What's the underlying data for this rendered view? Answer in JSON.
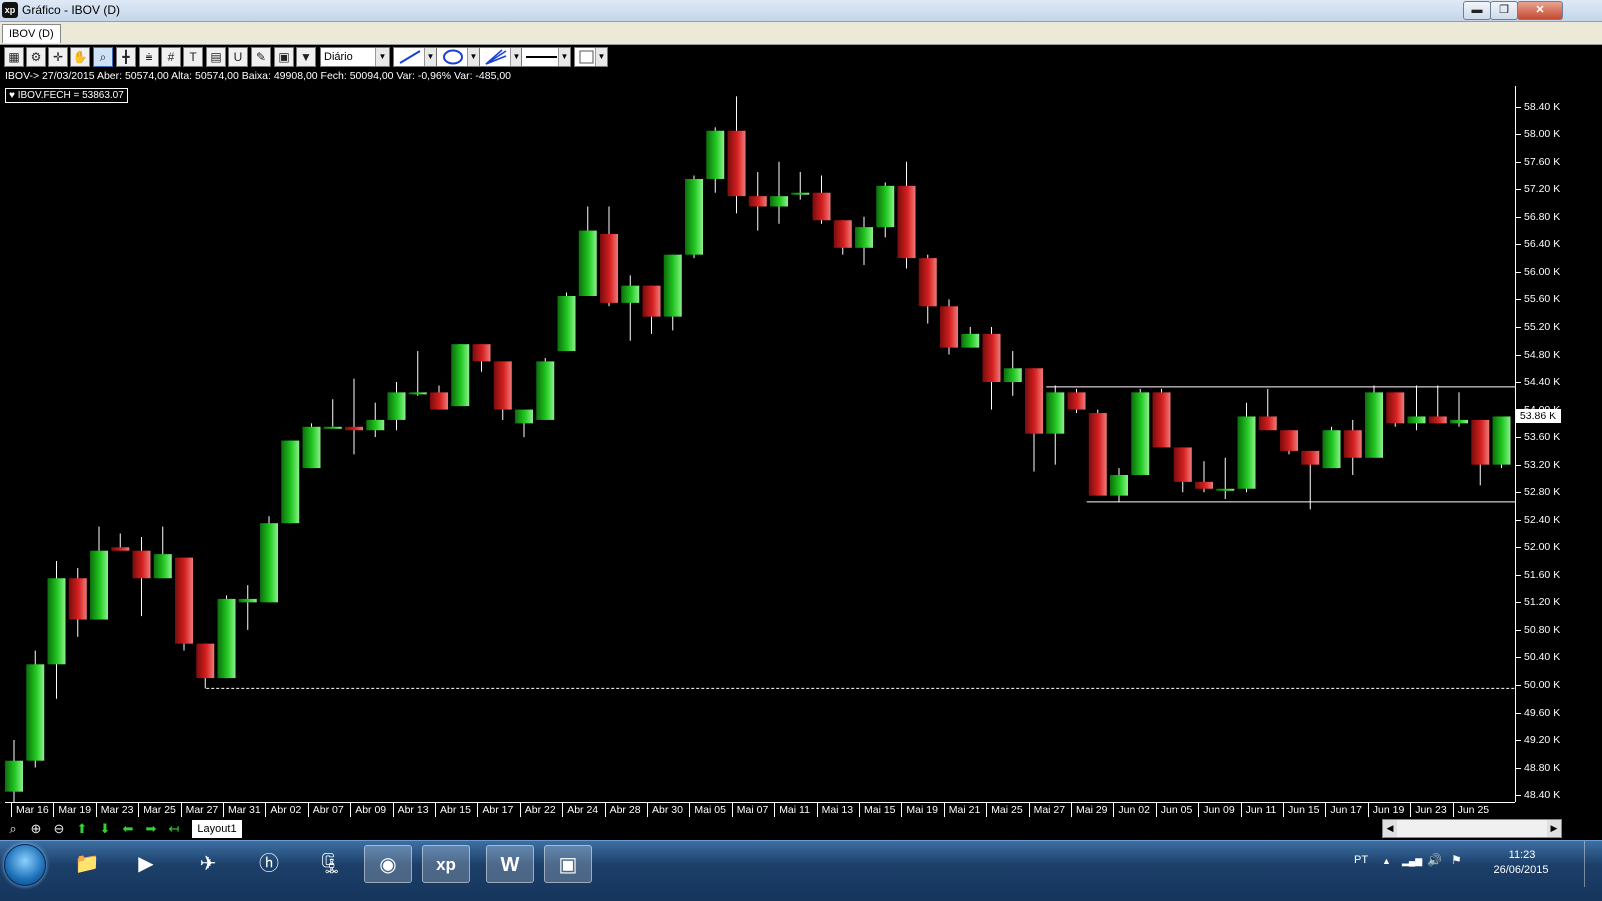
{
  "window": {
    "title": "Gráfico - IBOV (D)",
    "app_icon_text": "xp",
    "minimize_glyph": "▬",
    "maximize_glyph": "❐",
    "close_glyph": "✕",
    "document_tab": "IBOV (D)"
  },
  "toolbar": {
    "period_select": "Diário",
    "icons": [
      "chart-icon",
      "gear-icon",
      "crosshair-icon",
      "hand-icon",
      "zoom-chart-icon",
      "cursor-icon",
      "lines-icon",
      "grid-icon",
      "text-icon",
      "calculator-icon",
      "magnet-icon",
      "brush-icon",
      "clipboard-icon",
      "filter-icon"
    ],
    "glyphs": [
      "▦",
      "⚙",
      "✛",
      "✋",
      "⌕",
      "╋",
      "⩧",
      "#",
      "T",
      "▤",
      "U",
      "✎",
      "▣",
      "▼"
    ],
    "dropdown_arrow": "▼"
  },
  "info_line": "IBOV-> 27/03/2015 Aber: 50574,00 Alta: 50574,00 Baixa: 49908,00 Fech: 50094,00 Var: -0,96% Var: -485,00",
  "legend": "♥ IBOV.FECH = 53863.07",
  "current_price_label": "53.86 K",
  "colors": {
    "up": "#22c922",
    "down": "#d62020",
    "background": "#000000",
    "axis": "#ffffff"
  },
  "chart_data": {
    "type": "candlestick",
    "symbol": "IBOV",
    "ylim": [
      48300,
      58700
    ],
    "y_ticks": [
      "58.40 K",
      "58.00 K",
      "57.60 K",
      "57.20 K",
      "56.80 K",
      "56.40 K",
      "56.00 K",
      "55.60 K",
      "55.20 K",
      "54.80 K",
      "54.40 K",
      "54.00 K",
      "53.60 K",
      "53.20 K",
      "52.80 K",
      "52.40 K",
      "52.00 K",
      "51.60 K",
      "51.20 K",
      "50.80 K",
      "50.40 K",
      "50.00 K",
      "49.60 K",
      "49.20 K",
      "48.80 K",
      "48.40 K"
    ],
    "y_tick_values": [
      58400,
      58000,
      57600,
      57200,
      56800,
      56400,
      56000,
      55600,
      55200,
      54800,
      54400,
      54000,
      53600,
      53200,
      52800,
      52400,
      52000,
      51600,
      51200,
      50800,
      50400,
      50000,
      49600,
      49200,
      48800,
      48400
    ],
    "x_labels": [
      "Mar 16",
      "Mar 19",
      "Mar 23",
      "Mar 25",
      "Mar 27",
      "Mar 31",
      "Abr 02",
      "Abr 07",
      "Abr 09",
      "Abr 13",
      "Abr 15",
      "Abr 17",
      "Abr 22",
      "Abr 24",
      "Abr 28",
      "Abr 30",
      "Mai 05",
      "Mai 07",
      "Mai 11",
      "Mai 13",
      "Mai 15",
      "Mai 19",
      "Mai 21",
      "Mai 25",
      "Mai 27",
      "Mai 29",
      "Jun 02",
      "Jun 05",
      "Jun 09",
      "Jun 11",
      "Jun 15",
      "Jun 17",
      "Jun 19",
      "Jun 23",
      "Jun 25"
    ],
    "candles": [
      {
        "o": 48450,
        "h": 49200,
        "l": 48300,
        "c": 48900
      },
      {
        "o": 48900,
        "h": 50500,
        "l": 48800,
        "c": 50300
      },
      {
        "o": 50300,
        "h": 51800,
        "l": 49800,
        "c": 51550
      },
      {
        "o": 51550,
        "h": 51700,
        "l": 50700,
        "c": 50950
      },
      {
        "o": 50950,
        "h": 52300,
        "l": 50950,
        "c": 51950
      },
      {
        "o": 52000,
        "h": 52200,
        "l": 51950,
        "c": 51950
      },
      {
        "o": 51950,
        "h": 52150,
        "l": 51000,
        "c": 51550
      },
      {
        "o": 51550,
        "h": 52300,
        "l": 51550,
        "c": 51900
      },
      {
        "o": 51850,
        "h": 51850,
        "l": 50500,
        "c": 50600
      },
      {
        "o": 50600,
        "h": 50600,
        "l": 49950,
        "c": 50100
      },
      {
        "o": 50100,
        "h": 51300,
        "l": 50100,
        "c": 51250
      },
      {
        "o": 51200,
        "h": 51450,
        "l": 50800,
        "c": 51250
      },
      {
        "o": 51200,
        "h": 52450,
        "l": 51200,
        "c": 52350
      },
      {
        "o": 52350,
        "h": 53550,
        "l": 52350,
        "c": 53550
      },
      {
        "o": 53150,
        "h": 53800,
        "l": 53150,
        "c": 53750
      },
      {
        "o": 53750,
        "h": 54150,
        "l": 53750,
        "c": 53750
      },
      {
        "o": 53750,
        "h": 54450,
        "l": 53350,
        "c": 53700
      },
      {
        "o": 53700,
        "h": 54100,
        "l": 53600,
        "c": 53850
      },
      {
        "o": 53850,
        "h": 54400,
        "l": 53700,
        "c": 54250
      },
      {
        "o": 54250,
        "h": 54850,
        "l": 54200,
        "c": 54250
      },
      {
        "o": 54250,
        "h": 54350,
        "l": 54000,
        "c": 54000
      },
      {
        "o": 54050,
        "h": 54950,
        "l": 54050,
        "c": 54950
      },
      {
        "o": 54950,
        "h": 54950,
        "l": 54550,
        "c": 54700
      },
      {
        "o": 54700,
        "h": 54700,
        "l": 53850,
        "c": 54000
      },
      {
        "o": 53800,
        "h": 53950,
        "l": 53600,
        "c": 54000
      },
      {
        "o": 53850,
        "h": 54750,
        "l": 53850,
        "c": 54700
      },
      {
        "o": 54850,
        "h": 55700,
        "l": 54850,
        "c": 55650
      },
      {
        "o": 55650,
        "h": 56950,
        "l": 55650,
        "c": 56600
      },
      {
        "o": 56550,
        "h": 56950,
        "l": 55500,
        "c": 55550
      },
      {
        "o": 55550,
        "h": 55950,
        "l": 55000,
        "c": 55800
      },
      {
        "o": 55800,
        "h": 55800,
        "l": 55100,
        "c": 55350
      },
      {
        "o": 55350,
        "h": 56250,
        "l": 55150,
        "c": 56250
      },
      {
        "o": 56250,
        "h": 57400,
        "l": 56200,
        "c": 57350
      },
      {
        "o": 57350,
        "h": 58100,
        "l": 57150,
        "c": 58050
      },
      {
        "o": 58050,
        "h": 58550,
        "l": 56850,
        "c": 57100
      },
      {
        "o": 57100,
        "h": 57450,
        "l": 56600,
        "c": 56950
      },
      {
        "o": 56950,
        "h": 57600,
        "l": 56700,
        "c": 57100
      },
      {
        "o": 57150,
        "h": 57450,
        "l": 57050,
        "c": 57150
      },
      {
        "o": 57150,
        "h": 57400,
        "l": 56700,
        "c": 56750
      },
      {
        "o": 56750,
        "h": 56750,
        "l": 56250,
        "c": 56350
      },
      {
        "o": 56350,
        "h": 56800,
        "l": 56100,
        "c": 56650
      },
      {
        "o": 56650,
        "h": 57300,
        "l": 56500,
        "c": 57250
      },
      {
        "o": 57250,
        "h": 57600,
        "l": 56050,
        "c": 56200
      },
      {
        "o": 56200,
        "h": 56250,
        "l": 55250,
        "c": 55500
      },
      {
        "o": 55500,
        "h": 55600,
        "l": 54800,
        "c": 54900
      },
      {
        "o": 54900,
        "h": 55200,
        "l": 54900,
        "c": 55100
      },
      {
        "o": 55100,
        "h": 55200,
        "l": 54000,
        "c": 54400
      },
      {
        "o": 54400,
        "h": 54850,
        "l": 54200,
        "c": 54600
      },
      {
        "o": 54600,
        "h": 54600,
        "l": 53100,
        "c": 53650
      },
      {
        "o": 53650,
        "h": 54350,
        "l": 53200,
        "c": 54250
      },
      {
        "o": 54250,
        "h": 54300,
        "l": 53950,
        "c": 54000
      },
      {
        "o": 53950,
        "h": 54000,
        "l": 52750,
        "c": 52750
      },
      {
        "o": 52750,
        "h": 53150,
        "l": 52650,
        "c": 53050
      },
      {
        "o": 53050,
        "h": 54300,
        "l": 53050,
        "c": 54250
      },
      {
        "o": 54250,
        "h": 54300,
        "l": 53450,
        "c": 53450
      },
      {
        "o": 53450,
        "h": 53450,
        "l": 52800,
        "c": 52950
      },
      {
        "o": 52950,
        "h": 53250,
        "l": 52800,
        "c": 52850
      },
      {
        "o": 52850,
        "h": 53300,
        "l": 52700,
        "c": 52850
      },
      {
        "o": 52850,
        "h": 54100,
        "l": 52800,
        "c": 53900
      },
      {
        "o": 53900,
        "h": 54300,
        "l": 53700,
        "c": 53700
      },
      {
        "o": 53700,
        "h": 53700,
        "l": 53350,
        "c": 53400
      },
      {
        "o": 53400,
        "h": 53400,
        "l": 52550,
        "c": 53200
      },
      {
        "o": 53150,
        "h": 53750,
        "l": 53150,
        "c": 53700
      },
      {
        "o": 53700,
        "h": 53850,
        "l": 53050,
        "c": 53300
      },
      {
        "o": 53300,
        "h": 54350,
        "l": 53300,
        "c": 54250
      },
      {
        "o": 54250,
        "h": 54250,
        "l": 53750,
        "c": 53800
      },
      {
        "o": 53800,
        "h": 54350,
        "l": 53700,
        "c": 53900
      },
      {
        "o": 53900,
        "h": 54350,
        "l": 53800,
        "c": 53800
      },
      {
        "o": 53800,
        "h": 54250,
        "l": 53750,
        "c": 53850
      },
      {
        "o": 53850,
        "h": 53850,
        "l": 52900,
        "c": 53200
      },
      {
        "o": 53200,
        "h": 53900,
        "l": 53150,
        "c": 53900
      }
    ],
    "resistance_line": 54330,
    "support_line": 52660,
    "reference_level_dashed": 49950
  },
  "bottom_toolbar": {
    "icons": [
      "zoom-fit-icon",
      "zoom-in-icon",
      "zoom-out-icon",
      "arrow-up-icon",
      "arrow-down-icon",
      "arrow-left-icon",
      "arrow-right-icon",
      "arrow-back-icon"
    ],
    "glyphs": [
      "⌕",
      "⊕",
      "⊖",
      "⬆",
      "⬇",
      "⬅",
      "➡",
      "↤"
    ],
    "layout_tab": "Layout1",
    "scroll_left": "◀",
    "scroll_right": "▶"
  },
  "taskbar": {
    "apps": [
      "explorer-folder-icon",
      "media-player-icon",
      "network-app-icon",
      "hp-app-icon",
      "archive-app-icon",
      "chrome-icon",
      "xp-app-icon",
      "word-icon",
      "image-viewer-icon"
    ],
    "glyphs": [
      "📁",
      "▶",
      "✈",
      "ⓗ",
      "🗜",
      "◉",
      "xp",
      "W",
      "▣"
    ],
    "language": "PT",
    "tray_glyphs": [
      "▲",
      "▂▄▆",
      "🔊",
      "⚑"
    ],
    "time": "11:23",
    "date": "26/06/2015"
  }
}
